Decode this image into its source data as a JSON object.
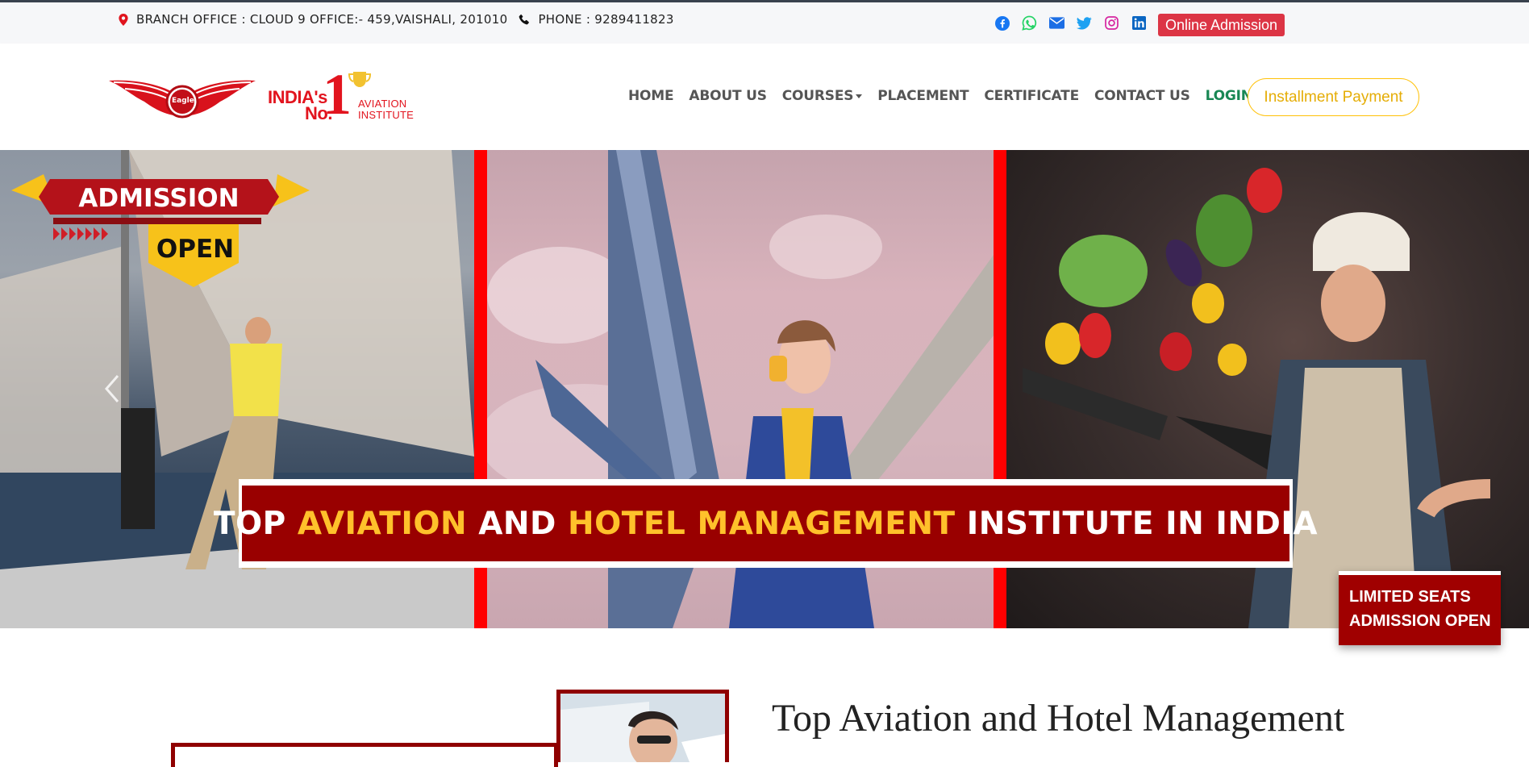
{
  "topbar": {
    "branch_office": "BRANCH OFFICE : CLOUD 9 OFFICE:- 459,VAISHALI, 201010",
    "phone": "PHONE : 9289411823",
    "socials": [
      "facebook-icon",
      "whatsapp-icon",
      "email-icon",
      "twitter-icon",
      "instagram-icon",
      "linkedin-icon"
    ],
    "online_admission": "Online Admission"
  },
  "logo": {
    "wing_text": "Eagle",
    "indias": "INDIA's",
    "no": "No.",
    "one": "1",
    "aviation": "AVIATION",
    "institute": "INSTITUTE"
  },
  "nav": {
    "items": [
      "HOME",
      "ABOUT US",
      "COURSES",
      "PLACEMENT",
      "CERTIFICATE",
      "CONTACT US"
    ],
    "login": "LOGIN",
    "installment": "Installment Payment"
  },
  "hero": {
    "badge_line1": "ADMISSION",
    "badge_line2": "OPEN",
    "banner": {
      "p1": "TOP ",
      "p2": "AVIATION",
      "p3": " AND ",
      "p4": "HOTEL MANAGEMENT",
      "p5": " INSTITUTE IN INDIA"
    },
    "limited_line1": "LIMITED SEATS",
    "limited_line2": "ADMISSION OPEN"
  },
  "about": {
    "title": "Top Aviation and Hotel Management"
  },
  "colors": {
    "accent_red": "#dc3545",
    "banner_red": "#990000",
    "highlight_yellow": "#ffc12b",
    "login_green": "#198754",
    "installment_yellow": "#ffc107"
  }
}
